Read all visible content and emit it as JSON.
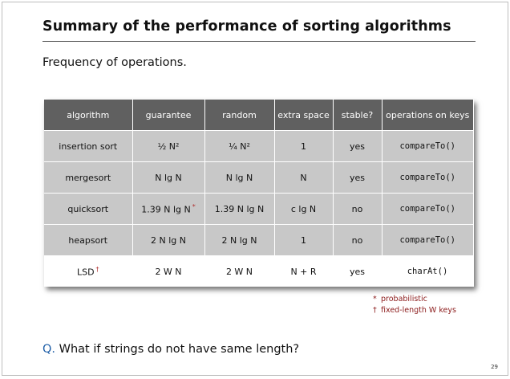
{
  "slide": {
    "title": "Summary of the performance of sorting algorithms",
    "subtitle": "Frequency of operations.",
    "page_number": "29"
  },
  "table": {
    "headers": [
      "algorithm",
      "guarantee",
      "random",
      "extra space",
      "stable?",
      "operations on keys"
    ],
    "rows": [
      {
        "algorithm": "insertion sort",
        "algorithm_mark": "",
        "guarantee": "½ N²",
        "guarantee_mark": "",
        "random": "¼ N²",
        "extra_space": "1",
        "stable": "yes",
        "operations": "compareTo()"
      },
      {
        "algorithm": "mergesort",
        "algorithm_mark": "",
        "guarantee": "N lg N",
        "guarantee_mark": "",
        "random": "N lg N",
        "extra_space": "N",
        "stable": "yes",
        "operations": "compareTo()"
      },
      {
        "algorithm": "quicksort",
        "algorithm_mark": "",
        "guarantee": "1.39 N lg N",
        "guarantee_mark": "*",
        "random": "1.39 N lg N",
        "extra_space": "c lg N",
        "stable": "no",
        "operations": "compareTo()"
      },
      {
        "algorithm": "heapsort",
        "algorithm_mark": "",
        "guarantee": "2 N lg N",
        "guarantee_mark": "",
        "random": "2 N lg N",
        "extra_space": "1",
        "stable": "no",
        "operations": "compareTo()"
      },
      {
        "algorithm": "LSD",
        "algorithm_mark": "†",
        "guarantee": "2 W N",
        "guarantee_mark": "",
        "random": "2 W N",
        "extra_space": "N + R",
        "stable": "yes",
        "operations": "charAt()"
      }
    ]
  },
  "notes": [
    {
      "symbol": "*",
      "text": "probabilistic"
    },
    {
      "symbol": "†",
      "text": "fixed-length W keys"
    }
  ],
  "question": {
    "label": "Q.",
    "text": "What if strings do not have same length?"
  },
  "colors": {
    "header_bg": "#606060",
    "row_bg": "#c8c8c8",
    "highlight_row_bg": "#ffffff",
    "note_color": "#8b1a1a",
    "question_label_color": "#1f5fa8"
  }
}
